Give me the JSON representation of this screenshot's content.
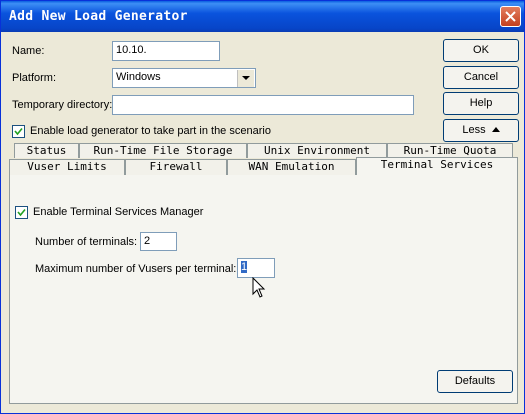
{
  "window": {
    "title": "Add New Load Generator"
  },
  "form": {
    "name_label": "Name:",
    "name_value": "10.10.",
    "platform_label": "Platform:",
    "platform_value": "Windows",
    "tempdir_label": "Temporary directory:",
    "tempdir_value": "",
    "enable_label": "Enable load generator to take part in the scenario",
    "enable_checked": true
  },
  "buttons": {
    "ok": "OK",
    "cancel": "Cancel",
    "help": "Help",
    "less": "Less",
    "defaults": "Defaults"
  },
  "tabs_row1": [
    "Status",
    "Run-Time File Storage",
    "Unix Environment",
    "Run-Time Quota"
  ],
  "tabs_row2": [
    "Vuser Limits",
    "Firewall",
    "WAN Emulation",
    "Terminal Services"
  ],
  "active_tab": "Terminal Services",
  "terminal": {
    "enable_label": "Enable Terminal Services Manager",
    "enable_checked": true,
    "num_label": "Number of terminals:",
    "num_value": "2",
    "max_label": "Maximum number of Vusers per terminal:",
    "max_value": "1"
  }
}
